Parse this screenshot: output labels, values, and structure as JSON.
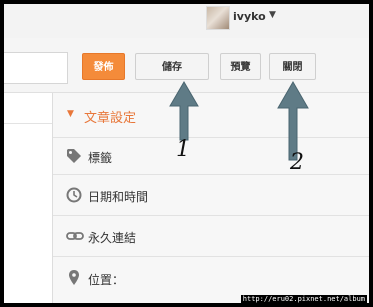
{
  "header": {
    "username": "ivyko"
  },
  "toolbar": {
    "publish_label": "發佈",
    "save_label": "儲存",
    "preview_label": "預覽",
    "close_label": "關閉"
  },
  "settings": {
    "title": "文章設定",
    "items": [
      {
        "label": "標籤",
        "icon": "tag-icon"
      },
      {
        "label": "日期和時間",
        "icon": "clock-icon"
      },
      {
        "label": "永久連結",
        "icon": "link-icon"
      },
      {
        "label": "位置：",
        "icon": "location-pin-icon"
      }
    ]
  },
  "annotations": {
    "mark_1": "1",
    "mark_2": "2"
  },
  "watermark": "http://eru02.pixnet.net/album",
  "colors": {
    "accent_orange": "#f48b3a",
    "arrow_slate": "#5f7b86"
  }
}
